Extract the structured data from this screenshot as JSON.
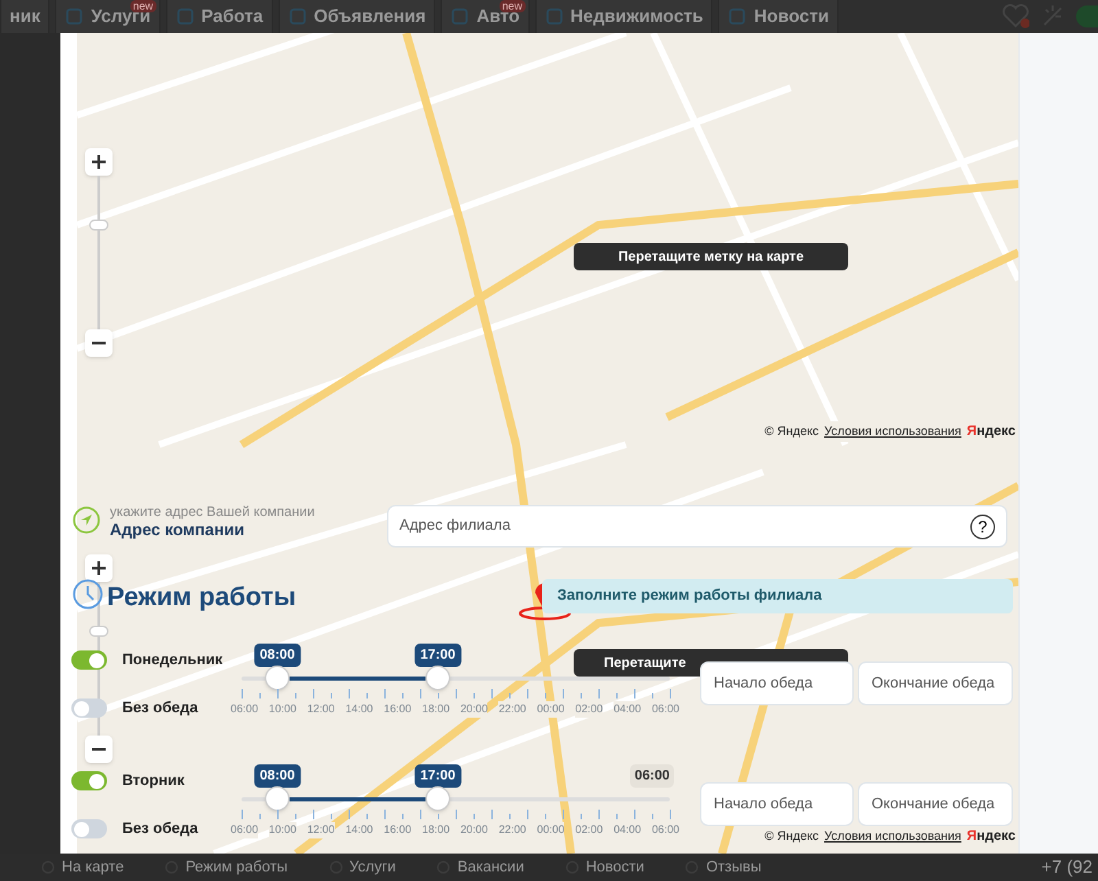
{
  "top_nav": {
    "items": [
      {
        "label": "ник"
      },
      {
        "label": "Услуги",
        "badge": "new"
      },
      {
        "label": "Работа"
      },
      {
        "label": "Объявления"
      },
      {
        "label": "Авто",
        "badge": "new"
      },
      {
        "label": "Недвижимость"
      },
      {
        "label": "Новости"
      }
    ]
  },
  "map_controls": [
    {
      "tooltip": "Перетащите метку на карте",
      "copyright": "© Яндекс",
      "terms_link": "Условия использования",
      "logo": "Яндекс"
    },
    {
      "tooltip": "Перетащите",
      "copyright": "© Яндекс",
      "terms_link": "Условия использования",
      "logo": "Яндекс"
    }
  ],
  "address": {
    "hint": "укажите адрес Вашей компании",
    "title": "Адрес компании",
    "field": {
      "placeholder": "Адрес филиала"
    },
    "help": "?"
  },
  "schedule": {
    "title": "Режим работы",
    "notice": "Заполните режим работы филиала",
    "days": [
      {
        "name": "Понедельник",
        "on": true,
        "handles": [
          {
            "label": "08:00",
            "level": 0.0833
          },
          {
            "label": "17:00",
            "level": 0.4583
          }
        ],
        "scale": [
          "06:00",
          "10:00",
          "12:00",
          "14:00",
          "16:00",
          "18:00",
          "20:00",
          "22:00",
          "00:00",
          "02:00",
          "04:00",
          "06:00"
        ],
        "no_lunch": {
          "label": "Без обеда",
          "on": false
        },
        "lunch_fields": [
          {
            "placeholder": "Начало обеда"
          },
          {
            "placeholder": "Окончание обеда"
          }
        ]
      },
      {
        "name": "Вторник",
        "on": true,
        "handles": [
          {
            "label": "08:00",
            "level": 0.0833
          },
          {
            "label": "17:00",
            "level": 0.4583
          }
        ],
        "end_badge": "06:00",
        "scale": [
          "06:00",
          "10:00",
          "12:00",
          "14:00",
          "16:00",
          "18:00",
          "20:00",
          "22:00",
          "00:00",
          "02:00",
          "04:00",
          "06:00"
        ],
        "no_lunch": {
          "label": "Без обеда",
          "on": false
        },
        "lunch_fields": [
          {
            "placeholder": "Начало обеда"
          },
          {
            "placeholder": "Окончание обеда"
          }
        ]
      }
    ]
  },
  "bottom_nav": {
    "items": [
      "На карте",
      "Режим работы",
      "Услуги",
      "Вакансии",
      "Новости",
      "Отзывы"
    ],
    "phone": "+7 (92"
  }
}
